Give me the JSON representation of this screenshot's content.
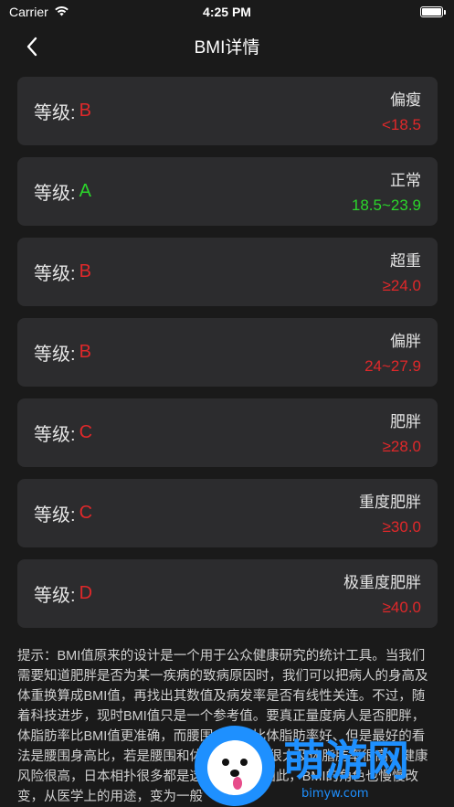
{
  "status_bar": {
    "carrier": "Carrier",
    "time": "4:25 PM"
  },
  "nav": {
    "title": "BMI详情"
  },
  "colors": {
    "red": "#e0282a",
    "green": "#2bd62b"
  },
  "cards": [
    {
      "grade_label": "等级:",
      "grade": "B",
      "grade_color": "#e0282a",
      "category": "偏瘦",
      "range": "<18.5",
      "range_color": "#e0282a"
    },
    {
      "grade_label": "等级:",
      "grade": "A",
      "grade_color": "#2bd62b",
      "category": "正常",
      "range": "18.5~23.9",
      "range_color": "#2bd62b"
    },
    {
      "grade_label": "等级:",
      "grade": "B",
      "grade_color": "#e0282a",
      "category": "超重",
      "range": "≥24.0",
      "range_color": "#e0282a"
    },
    {
      "grade_label": "等级:",
      "grade": "B",
      "grade_color": "#e0282a",
      "category": "偏胖",
      "range": "24~27.9",
      "range_color": "#e0282a"
    },
    {
      "grade_label": "等级:",
      "grade": "C",
      "grade_color": "#e0282a",
      "category": "肥胖",
      "range": "≥28.0",
      "range_color": "#e0282a"
    },
    {
      "grade_label": "等级:",
      "grade": "C",
      "grade_color": "#e0282a",
      "category": "重度肥胖",
      "range": "≥30.0",
      "range_color": "#e0282a"
    },
    {
      "grade_label": "等级:",
      "grade": "D",
      "grade_color": "#e0282a",
      "category": "极重度肥胖",
      "range": "≥40.0",
      "range_color": "#e0282a"
    }
  ],
  "tip": {
    "text": "提示：BMI值原来的设计是一个用于公众健康研究的统计工具。当我们需要知道肥胖是否为某一疾病的致病原因时，我们可以把病人的身高及体重换算成BMI值，再找出其数值及病发率是否有线性关连。不过，随着科技进步，现时BMI值只是一个参考值。要真正量度病人是否肥胖，体脂肪率比BMI值更准确，而腰围身高比比体脂肪率好、但是最好的看法是腰围身高比，若是腰围和体脂肪率范围很大及体脂肪率很高，健康风险很高，日本相扑很多都是这种胖法）。因此，BMI的角色也慢慢改变，从医学上的用途，变为一般"
  },
  "watermark": {
    "brand": "萌游网",
    "url": "bimyw.com"
  }
}
